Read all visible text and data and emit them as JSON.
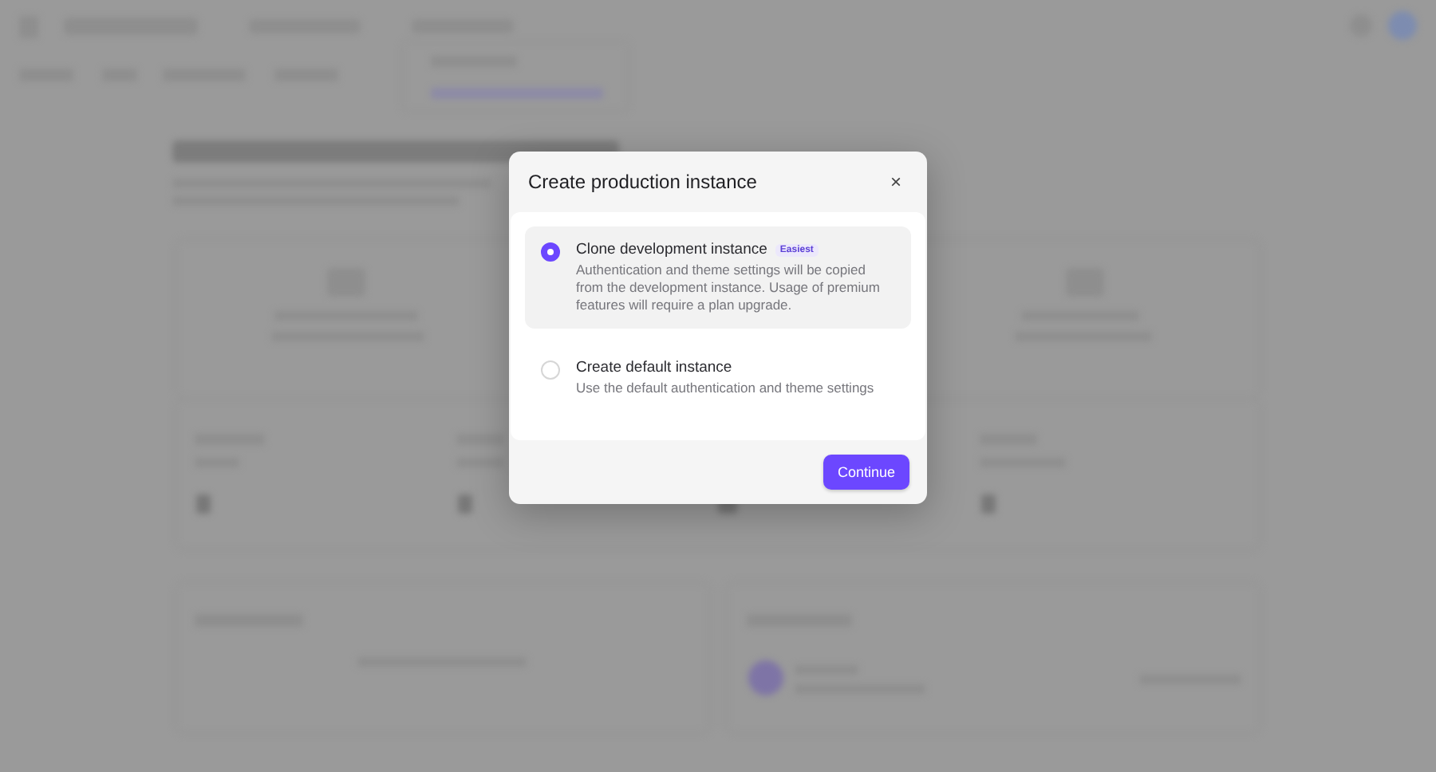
{
  "dialog": {
    "title": "Create production instance",
    "close": "×",
    "options": [
      {
        "title": "Clone development instance",
        "badge": "Easiest",
        "description": "Authentication and theme settings will be copied from the development instance. Usage of premium features will require a plan upgrade.",
        "selected": true
      },
      {
        "title": "Create default instance",
        "description": "Use the default authentication and theme settings",
        "selected": false
      }
    ],
    "button": "Continue"
  }
}
